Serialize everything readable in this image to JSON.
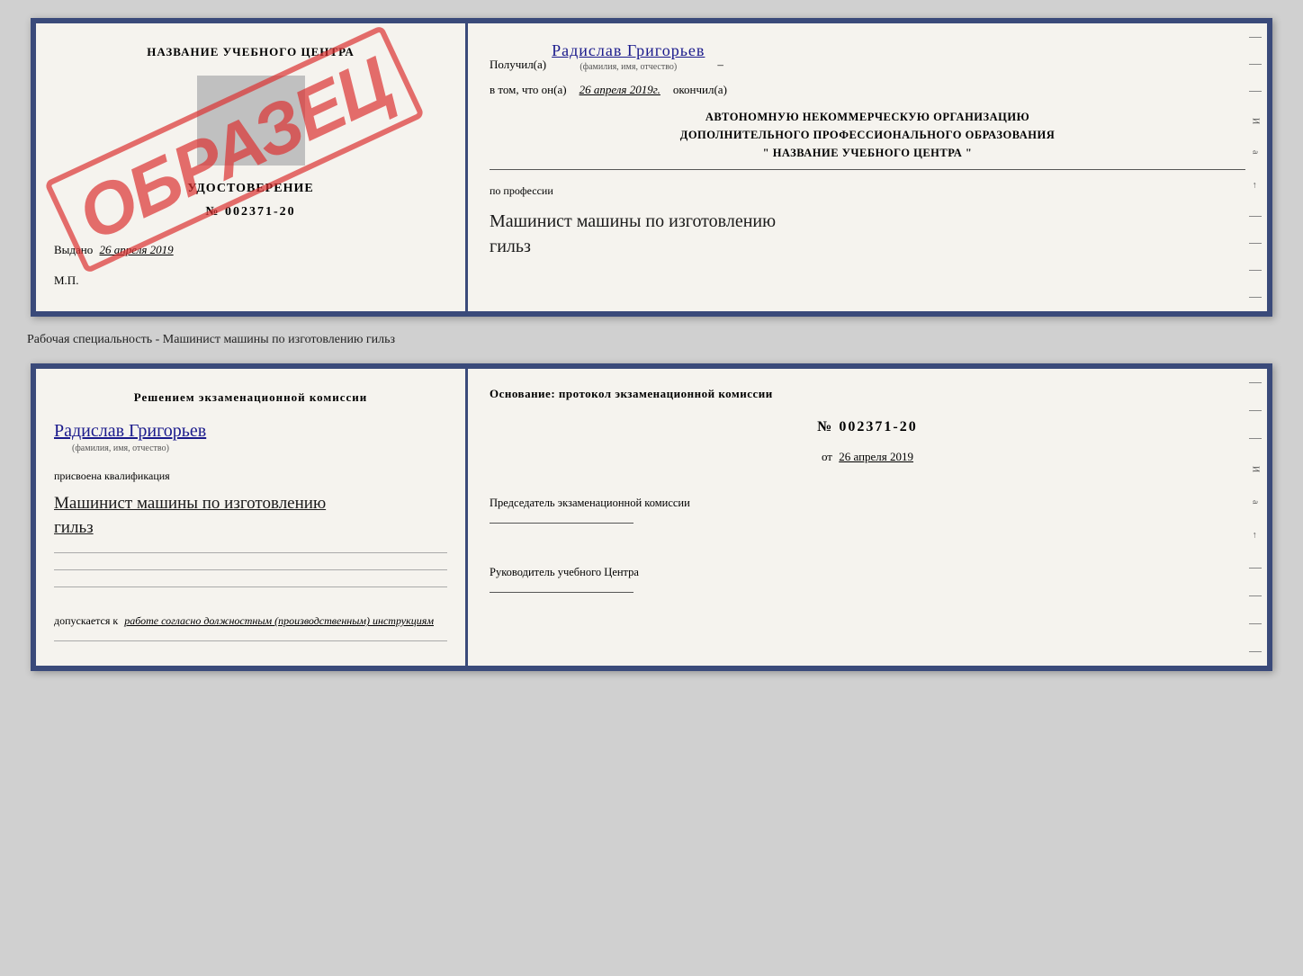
{
  "topDoc": {
    "left": {
      "centerTitle": "НАЗВАНИЕ УЧЕБНОГО ЦЕНТРА",
      "udostoverenie": "УДОСТОВЕРЕНИЕ",
      "number": "№ 002371-20",
      "vydano": "Выдано",
      "vydanoDate": "26 апреля 2019",
      "mp": "М.П.",
      "obrazets": "ОБРАЗЕЦ"
    },
    "right": {
      "poluchil": "Получил(а)",
      "name": "Радислав Григорьев",
      "fioHint": "(фамилия, имя, отчество)",
      "dash1": "–",
      "vtomChto": "в том, что он(а)",
      "date": "26 апреля 2019г.",
      "okonchil": "окончил(а)",
      "orgLine1": "АВТОНОМНУЮ НЕКОММЕРЧЕСКУЮ ОРГАНИЗАЦИЮ",
      "orgLine2": "ДОПОЛНИТЕЛЬНОГО ПРОФЕССИОНАЛЬНОГО ОБРАЗОВАНИЯ",
      "orgName": "\" НАЗВАНИЕ УЧЕБНОГО ЦЕНТРА \"",
      "poProfessii": "по профессии",
      "professionLine1": "Машинист машины по изготовлению",
      "professionLine2": "гильз"
    }
  },
  "caption": "Рабочая специальность - Машинист машины по изготовлению гильз",
  "bottomDoc": {
    "left": {
      "resheniyem": "Решением  экзаменационной  комиссии",
      "name": "Радислав Григорьев",
      "fioHint": "(фамилия, имя, отчество)",
      "prisvoena": "присвоена квалификация",
      "qualLine1": "Машинист машины по изготовлению",
      "qualLine2": "гильз",
      "dopuskaetsya": "допускается к",
      "dopuskaetsyaText": "работе согласно должностным (производственным) инструкциям"
    },
    "right": {
      "osnovanie": "Основание: протокол экзаменационной  комиссии",
      "number": "№  002371-20",
      "ot": "от",
      "otDate": "26 апреля 2019",
      "predsedatel": "Председатель экзаменационной комиссии",
      "rukovoditel": "Руководитель учебного Центра"
    }
  },
  "sideDecorations": {
    "letters": [
      "И",
      "а",
      "←"
    ]
  }
}
